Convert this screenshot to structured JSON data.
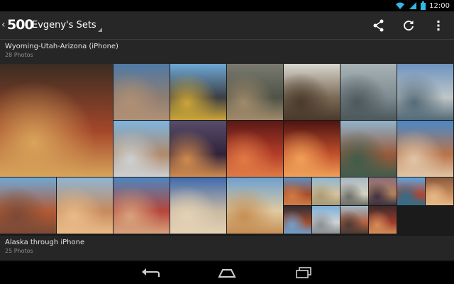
{
  "status_bar": {
    "time": "12:00",
    "icons": [
      "wifi-icon",
      "signal-icon",
      "battery-icon"
    ]
  },
  "action_bar": {
    "logo": "500",
    "title": "Evgeny's Sets",
    "actions": [
      "share-icon",
      "refresh-icon",
      "overflow-menu-icon"
    ]
  },
  "sets": [
    {
      "title": "Wyoming-Utah-Arizona (iPhone)",
      "count": "28 Photos",
      "photos": [
        {
          "name": "red-rock-swirl",
          "colors": [
            "#3b2c22",
            "#a5472a",
            "#d8a45a"
          ]
        },
        {
          "name": "desert-dusk-dunes",
          "colors": [
            "#4f7aa6",
            "#8e7d72",
            "#b09075"
          ]
        },
        {
          "name": "road-yellow-lines",
          "colors": [
            "#6ea8d6",
            "#3b3e44",
            "#caa437"
          ]
        },
        {
          "name": "misty-lake",
          "colors": [
            "#7a7a70",
            "#4e5247",
            "#a08a6a"
          ]
        },
        {
          "name": "trail-sign",
          "colors": [
            "#d8d6cf",
            "#7b6a55",
            "#4a3a2c"
          ]
        },
        {
          "name": "foggy-forest",
          "colors": [
            "#a9b3b6",
            "#7d8b91",
            "#4d585b"
          ]
        },
        {
          "name": "mountain-lake-shore",
          "colors": [
            "#6e93bf",
            "#bfc7c8",
            "#556b78"
          ]
        },
        {
          "name": "car-canyon-overlook",
          "colors": [
            "#7db5df",
            "#b0896a",
            "#cdd1d2"
          ]
        },
        {
          "name": "sunset-mesa",
          "colors": [
            "#574c6a",
            "#30233a",
            "#d08a4e"
          ]
        },
        {
          "name": "antelope-canyon-red",
          "colors": [
            "#5a1916",
            "#b43d28",
            "#e07a45"
          ]
        },
        {
          "name": "antelope-canyon-orange",
          "colors": [
            "#4d1412",
            "#c1502b",
            "#f0a058"
          ]
        },
        {
          "name": "horseshoe-bend",
          "colors": [
            "#8fb4cc",
            "#9b5a3a",
            "#3f5d4c"
          ]
        },
        {
          "name": "canyon-vista-blue",
          "colors": [
            "#4a88c6",
            "#b9744b",
            "#e0c5a6"
          ]
        },
        {
          "name": "canyon-pano-left",
          "colors": [
            "#6fa8d6",
            "#b35a35",
            "#7a4a36"
          ]
        },
        {
          "name": "canyon-hoodoo-right",
          "colors": [
            "#8fb5d4",
            "#c78a5c",
            "#e9bb88"
          ]
        },
        {
          "name": "monument-road",
          "colors": [
            "#4d86c0",
            "#b6453a",
            "#d7a37d"
          ]
        },
        {
          "name": "white-swirl-rock",
          "colors": [
            "#3e6ab0",
            "#c8b9a2",
            "#e4d1b5"
          ]
        },
        {
          "name": "suv-desert",
          "colors": [
            "#6ca0d0",
            "#e0caa0",
            "#c68f55"
          ]
        },
        {
          "name": "delicate-arch",
          "colors": [
            "#5d8fc2",
            "#a84b2a",
            "#d07c45"
          ]
        },
        {
          "name": "slickrock-valley",
          "colors": [
            "#8eb7d5",
            "#d6c29a",
            "#a99b78"
          ]
        },
        {
          "name": "gray-cliffs",
          "colors": [
            "#a9b8c4",
            "#d4d2c2",
            "#6d6e68"
          ]
        },
        {
          "name": "purple-canyon",
          "colors": [
            "#8c6e7c",
            "#b1825c",
            "#3e3141"
          ]
        },
        {
          "name": "hiker-red-canyon",
          "colors": [
            "#5ba7e0",
            "#b5432e",
            "#2d6f8f"
          ]
        },
        {
          "name": "sandstone-wave",
          "colors": [
            "#8a5a3e",
            "#c98c5a",
            "#e6b888"
          ]
        },
        {
          "name": "arch-window",
          "colors": [
            "#2e2e36",
            "#a24b2e",
            "#6fa0cc"
          ]
        },
        {
          "name": "parking-lot-cars",
          "colors": [
            "#7aaedb",
            "#cfd3d4",
            "#8a8f93"
          ]
        },
        {
          "name": "canyon-overlook-shadow",
          "colors": [
            "#9fb7c8",
            "#b16240",
            "#4c3a34"
          ]
        },
        {
          "name": "red-valley",
          "colors": [
            "#3c2a2a",
            "#9b3a2c",
            "#d58d57"
          ]
        }
      ]
    },
    {
      "title": "Alaska through iPhone",
      "count": "25 Photos"
    }
  ]
}
